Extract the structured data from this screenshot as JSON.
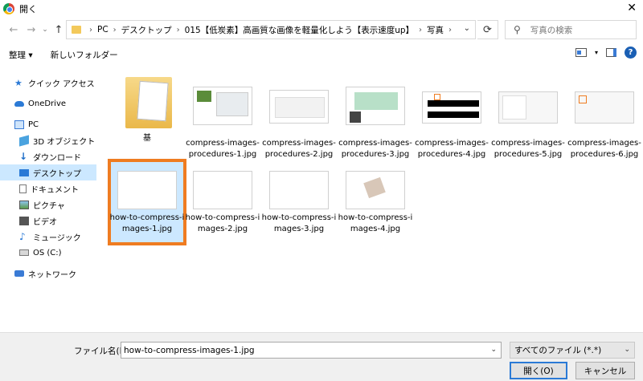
{
  "window": {
    "title": "開く",
    "close": "✕"
  },
  "nav": {
    "back": "←",
    "forward": "→",
    "up": "↑"
  },
  "address": {
    "crumbs": [
      "PC",
      "デスクトップ",
      "015【低炭素】高画質な画像を軽量化しよう【表示速度up】",
      "写真"
    ]
  },
  "search": {
    "placeholder": "写真の検索"
  },
  "toolbar": {
    "organize": "整理 ▾",
    "new_folder": "新しいフォルダー"
  },
  "sidebar": {
    "items": [
      {
        "label": "クイック アクセス",
        "icon": "star-icon"
      },
      {
        "label": "OneDrive",
        "icon": "cloud-icon"
      },
      {
        "label": "PC",
        "icon": "pc-icon"
      },
      {
        "label": "3D オブジェクト",
        "icon": "cube-icon"
      },
      {
        "label": "ダウンロード",
        "icon": "download-icon"
      },
      {
        "label": "デスクトップ",
        "icon": "desktop-icon",
        "selected": true
      },
      {
        "label": "ドキュメント",
        "icon": "document-icon"
      },
      {
        "label": "ピクチャ",
        "icon": "pictures-icon"
      },
      {
        "label": "ビデオ",
        "icon": "video-icon"
      },
      {
        "label": "ミュージック",
        "icon": "music-icon"
      },
      {
        "label": "OS (C:)",
        "icon": "drive-icon"
      },
      {
        "label": "ネットワーク",
        "icon": "network-icon"
      }
    ]
  },
  "files": [
    {
      "name": "基",
      "type": "folder"
    },
    {
      "name": "compress-images-procedures-1.jpg",
      "type": "doc"
    },
    {
      "name": "compress-images-procedures-2.jpg",
      "type": "doc"
    },
    {
      "name": "compress-images-procedures-3.jpg",
      "type": "doc"
    },
    {
      "name": "compress-images-procedures-4.jpg",
      "type": "dark"
    },
    {
      "name": "compress-images-procedures-5.jpg",
      "type": "doc"
    },
    {
      "name": "compress-images-procedures-6.jpg",
      "type": "doc"
    },
    {
      "name": "how-to-compress-images-1.jpg",
      "type": "sky",
      "selected": true
    },
    {
      "name": "how-to-compress-images-2.jpg",
      "type": "sea"
    },
    {
      "name": "how-to-compress-images-3.jpg",
      "type": "sea"
    },
    {
      "name": "how-to-compress-images-4.jpg",
      "type": "wood"
    }
  ],
  "footer": {
    "filename_label": "ファイル名(N):",
    "filename_value": "how-to-compress-images-1.jpg",
    "filetype": "すべてのファイル (*.*)",
    "open": "開く(O)",
    "cancel": "キャンセル"
  },
  "colors": {
    "selection": "#cce8ff",
    "highlight_border": "#ef7c21",
    "accent": "#2b7ad6"
  }
}
